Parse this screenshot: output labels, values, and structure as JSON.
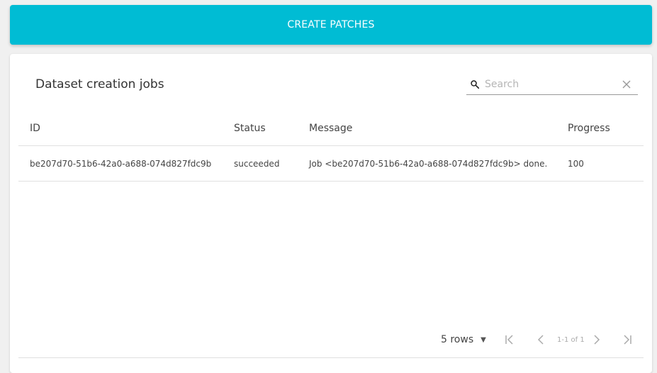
{
  "toolbar": {
    "create_label": "CREATE PATCHES"
  },
  "card": {
    "title": "Dataset creation jobs"
  },
  "search": {
    "placeholder": "Search",
    "value": ""
  },
  "table": {
    "headers": {
      "id": "ID",
      "status": "Status",
      "message": "Message",
      "progress": "Progress"
    },
    "rows": [
      {
        "id": "be207d70-51b6-42a0-a688-074d827fdc9b",
        "status": "succeeded",
        "message": "Job <be207d70-51b6-42a0-a688-074d827fdc9b> done.",
        "progress": "100"
      }
    ]
  },
  "pagination": {
    "rows_label": "5 rows",
    "range_text": "1-1 of 1"
  },
  "colors": {
    "accent": "#00bcd4"
  },
  "icons": [
    "search-icon",
    "close-icon",
    "caret-down-icon",
    "first-page-icon",
    "previous-page-icon",
    "next-page-icon",
    "last-page-icon"
  ]
}
